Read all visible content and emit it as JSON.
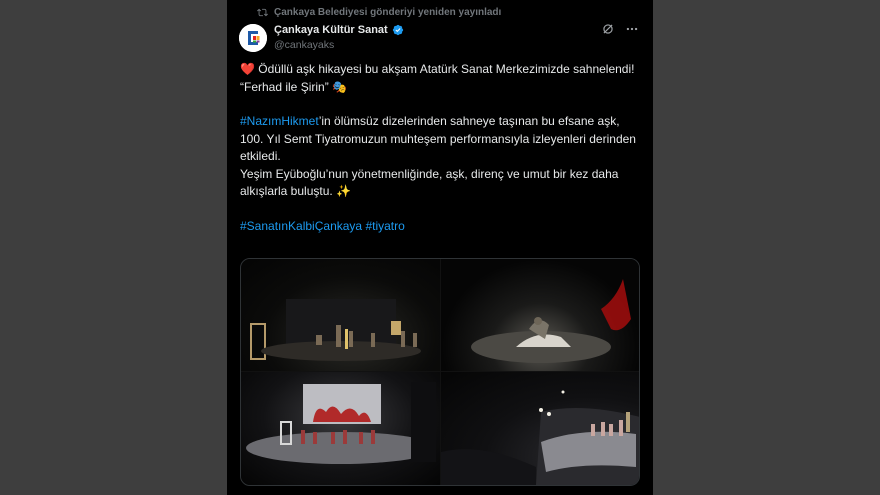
{
  "repost_notice": "Çankaya Belediyesi gönderiyi yeniden yayınladı",
  "author": {
    "name": "Çankaya Kültür Sanat",
    "handle": "@cankayaks",
    "verified_icon": "verified-badge-icon"
  },
  "icons": {
    "repost": "repost-icon",
    "grok": "grok-icon",
    "more": "more-icon"
  },
  "tweet": {
    "line1_emoji": "❤️",
    "line1": " Ödüllü aşk hikayesi bu akşam Atatürk Sanat Merkezimizde sahnelendi!",
    "line2": "“Ferhad ile Şirin” ",
    "line2_emoji": "🎭",
    "hashtag1": "#NazımHikmet",
    "para2_rest": "’in ölümsüz dizelerinden sahneye taşınan bu efsane aşk, 100. Yıl Semt Tiyatromuzun muhteşem performansıyla izleyenleri derinden etkiledi.",
    "para3": "Yeşim Eyüboğlu’nun yönetmenliğinde, aşk, direnç ve umut bir kez daha alkışlarla buluştu. ",
    "para3_emoji": "✨",
    "hashtag2": "#SanatınKalbiÇankaya",
    "hashtag3": "#tiyatro"
  },
  "media_count": 4,
  "colors": {
    "background": "#000000",
    "sidebar": "#3e3e3e",
    "text": "#e7e9ea",
    "muted": "#71767b",
    "link": "#1d9bf0"
  }
}
